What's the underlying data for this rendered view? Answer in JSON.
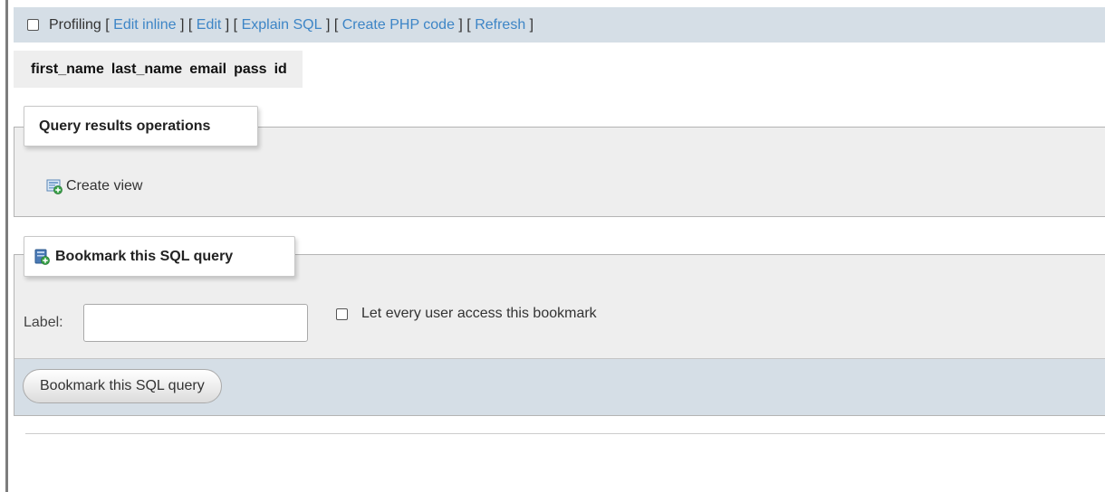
{
  "profiling": {
    "checkbox_label": "Profiling",
    "links": [
      "Edit inline",
      "Edit",
      "Explain SQL",
      "Create PHP code",
      "Refresh"
    ]
  },
  "results": {
    "columns": [
      "first_name",
      "last_name",
      "email",
      "pass",
      "id"
    ]
  },
  "query_ops": {
    "legend": "Query results operations",
    "create_view_label": "Create view",
    "create_view_icon": "create-view-icon"
  },
  "bookmark": {
    "legend": "Bookmark this SQL query",
    "legend_icon": "bookmark-icon",
    "label_text": "Label:",
    "label_value": "",
    "access_label": "Let every user access this bookmark",
    "submit_label": "Bookmark this SQL query"
  },
  "colors": {
    "link": "#3d85c6",
    "bar_bg": "#d5dee6",
    "panel_bg": "#eeeeee"
  }
}
